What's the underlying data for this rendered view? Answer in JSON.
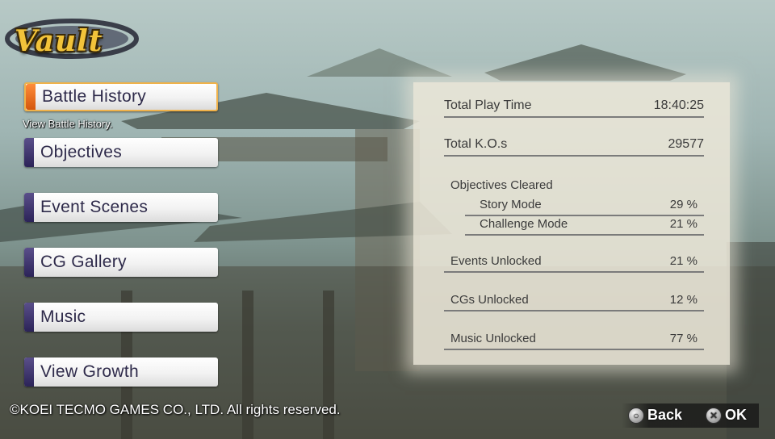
{
  "screen": {
    "title": "Vault"
  },
  "menu": {
    "items": [
      {
        "label": "Battle History",
        "active": true
      },
      {
        "label": "Objectives"
      },
      {
        "label": "Event Scenes"
      },
      {
        "label": "CG Gallery"
      },
      {
        "label": "Music"
      },
      {
        "label": "View Growth"
      }
    ],
    "description": "View Battle History."
  },
  "stats": {
    "play_time": {
      "label": "Total Play Time",
      "value": "18:40:25"
    },
    "kos": {
      "label": "Total K.O.s",
      "value": "29577"
    },
    "objectives": {
      "label": "Objectives Cleared",
      "story": {
        "label": "Story Mode",
        "value": "29 %"
      },
      "challenge": {
        "label": "Challenge Mode",
        "value": "21 %"
      }
    },
    "events": {
      "label": "Events Unlocked",
      "value": "21 %"
    },
    "cgs": {
      "label": "CGs Unlocked",
      "value": "12 %"
    },
    "music": {
      "label": "Music Unlocked",
      "value": "77 %"
    }
  },
  "footer": {
    "copyright": "©KOEI TECMO GAMES CO., LTD. All rights reserved.",
    "back_label": "Back",
    "ok_label": "OK",
    "back_icon": "circle-button-icon",
    "ok_icon": "cross-button-icon"
  },
  "colors": {
    "accent_active": "#f0b24a",
    "menu_tab": "#2b2358",
    "logo": "#f2c33a"
  }
}
